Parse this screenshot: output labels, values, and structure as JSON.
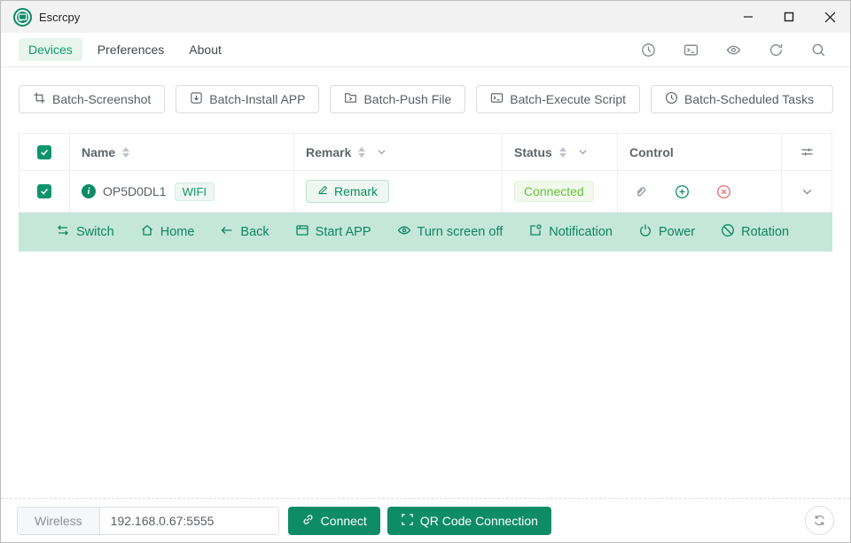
{
  "window": {
    "title": "Escrcpy"
  },
  "nav": {
    "tabs": [
      "Devices",
      "Preferences",
      "About"
    ],
    "active_tab": "Devices"
  },
  "toolbar": {
    "icons": [
      "history",
      "terminal",
      "eye",
      "refresh",
      "search"
    ]
  },
  "batch": {
    "buttons": [
      "Batch-Screenshot",
      "Batch-Install APP",
      "Batch-Push File",
      "Batch-Execute Script",
      "Batch-Scheduled Tasks"
    ]
  },
  "table": {
    "headers": {
      "name": "Name",
      "remark": "Remark",
      "status": "Status",
      "control": "Control"
    },
    "device": {
      "name": "OP5D0DL1",
      "connection_badge": "WIFI",
      "remark_button": "Remark",
      "status": "Connected"
    }
  },
  "device_actions": [
    "Switch",
    "Home",
    "Back",
    "Start APP",
    "Turn screen off",
    "Notification",
    "Power",
    "Rotation"
  ],
  "footer": {
    "mode_select": "Wireless",
    "address": "192.168.0.67:5555",
    "connect": "Connect",
    "qr": "QR Code Connection"
  },
  "colors": {
    "accent": "#0e8c64",
    "accent_light_bg": "#e7f5ee",
    "success": "#67c23a",
    "danger": "#f56c6c",
    "expanded_bg": "#c5e7d9"
  }
}
